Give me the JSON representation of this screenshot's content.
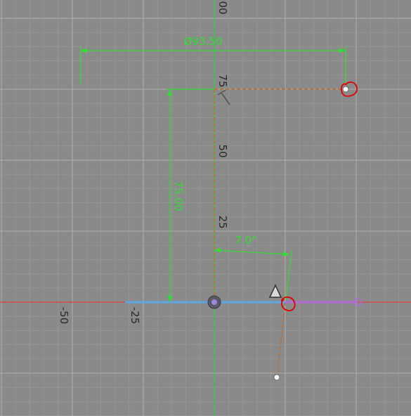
{
  "viewport": {
    "background": "#8a8a8a",
    "grid_minor_color": "#9a9a9a",
    "grid_major_color": "#b0b0b0"
  },
  "axes": {
    "x_axis_color": "#e0413a",
    "y_axis_color": "#33cc44",
    "horizontal_labels": [
      "-50",
      "-25"
    ],
    "vertical_labels": [
      "25",
      "50",
      "75",
      "00"
    ]
  },
  "dimensions": {
    "diameter_label": "Ø93.50",
    "height_label": "75.00",
    "angle_label": "7.0°",
    "color": "#33dd33"
  },
  "sketch": {
    "construction_color": "#c07030",
    "base_line_color": "#5aa6e6",
    "profile_line_color": "#b36ad8",
    "origin_icon": "origin-point-icon",
    "triangle_icon": "warning-triangle-icon",
    "markup_color": "#e00000"
  }
}
